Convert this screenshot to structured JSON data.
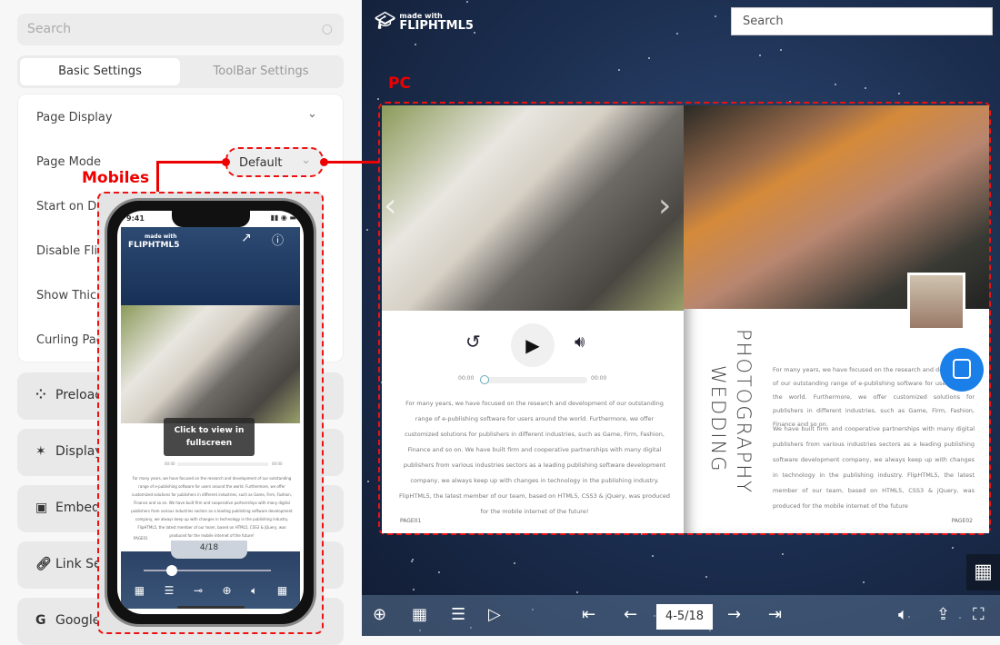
{
  "sidebar": {
    "search_placeholder": "Search",
    "tabs": [
      {
        "label": "Basic Settings",
        "active": true
      },
      {
        "label": "ToolBar Settings",
        "active": false
      }
    ],
    "page_display": {
      "title": "Page Display",
      "rows": [
        {
          "label": "Page Mode",
          "value": "Default"
        },
        {
          "label": "Start on Do"
        },
        {
          "label": "Disable Flip"
        },
        {
          "label": "Show Thick"
        },
        {
          "label": "Curling Pag"
        }
      ]
    },
    "sections": [
      {
        "label": "Preload",
        "icon": "spinner-icon"
      },
      {
        "label": "Display",
        "icon": "magic-wand-icon"
      },
      {
        "label": "Embed",
        "icon": "code-window-icon"
      },
      {
        "label": "Link Se",
        "icon": "link-icon"
      },
      {
        "label": "Google",
        "icon": "google-icon"
      }
    ]
  },
  "annotations": {
    "pc": "PC",
    "mobiles": "Mobiles",
    "color": "#e00000"
  },
  "viewer": {
    "logo_top": "made with",
    "logo_main": "FLIPHTML5",
    "search_placeholder": "Search",
    "audio": {
      "start": "00:00",
      "end": "00:00"
    },
    "left_text": "For many years, we have focused on the research and development of our outstanding range of e-publishing software for users around the world. Furthermore, we offer customized solutions for publishers in different industries, such as Game, Firm, Fashion, Finance and so on. We have built firm and cooperative partnerships with many digital publishers from various industries sectors as a leading publishing software development company, we always keep up with changes in technology in the publishing industry.  FlipHTML5, the latest member of our team, based on HTML5, CSS3 & jQuery, was produced for the mobile internet of the future!",
    "title_line1": "WEDDING",
    "title_line2": "PHOTOGRAPHY",
    "right_text1": "For many years, we have focused on the research and development of our outstanding range of e-publishing software for users around the world. Furthermore, we offer customized solutions for publishers in different industries, such as Game, Firm, Fashion, Finance and so on.",
    "right_text2": "We have built firm and cooperative partnerships with many digital publishers from various industries sectors as a leading publishing software development company, we always keep up with changes in technology in the publishing industry.  FlipHTML5, the latest member of our team, based on HTML5, CSS3 & jQuery, was produced for the mobile internet of the future",
    "page_left": "PAGE01",
    "page_right": "PAGE02",
    "page_indicator": "4-5/18"
  },
  "mobile": {
    "time": "9:41",
    "overlay": "Click to view in fullscreen",
    "audio_start": "00:00",
    "audio_end": "00:00",
    "page_indicator": "4/18",
    "page_label": "PAGE01",
    "slider_fraction": 0.22
  }
}
